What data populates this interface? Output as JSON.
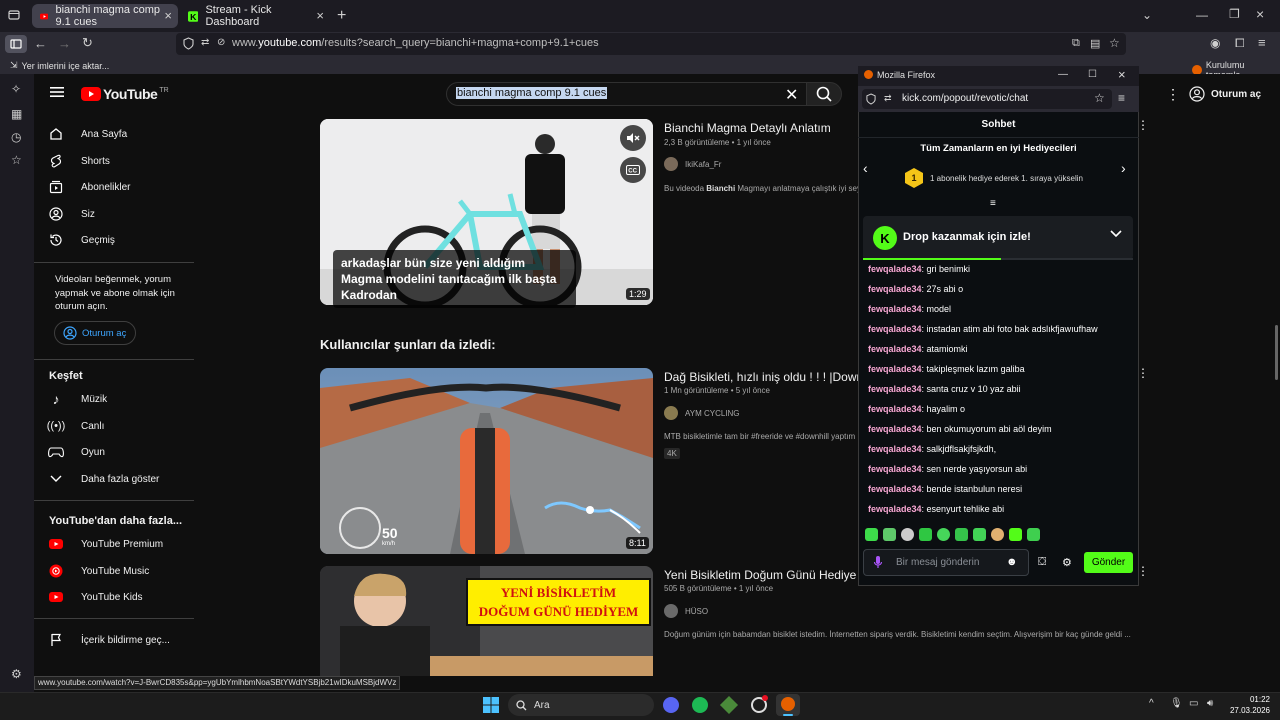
{
  "browser": {
    "tabs": [
      {
        "label": "bianchi magma comp 9.1 cues"
      },
      {
        "label": "Stream - Kick Dashboard"
      }
    ],
    "url_prefix": "www.",
    "url_host": "youtube.com",
    "url_path": "/results?search_query=bianchi+magma+comp+9.1+cues",
    "bookmarks_import": "Yer imlerini içe aktar...",
    "bookmarks_right": "Kurulumu tamamla",
    "status_url": "www.youtube.com/watch?v=J-BwrCD835s&pp=ygUbYmlhbmNoaSBtYWdtYSBjb21wIDkuMSBjdWVz"
  },
  "youtube": {
    "logo_text": "YouTube",
    "logo_region": "TR",
    "search_value": "bianchi magma comp 9.1 cues",
    "signin_label": "Oturum aç",
    "nav": [
      {
        "label": "Ana Sayfa"
      },
      {
        "label": "Shorts"
      },
      {
        "label": "Abonelikler"
      },
      {
        "label": "Siz"
      },
      {
        "label": "Geçmiş"
      }
    ],
    "signin_prompt": "Videoları beğenmek, yorum yapmak ve abone olmak için oturum açın.",
    "signin_button": "Oturum aç",
    "explore_heading": "Keşfet",
    "explore": [
      {
        "label": "Müzik"
      },
      {
        "label": "Canlı"
      },
      {
        "label": "Oyun"
      },
      {
        "label": "Daha fazla göster"
      }
    ],
    "more_heading": "YouTube'dan daha fazla...",
    "more": [
      {
        "label": "YouTube Premium"
      },
      {
        "label": "YouTube Music"
      },
      {
        "label": "YouTube Kids"
      }
    ],
    "report_history": "İçerik bildirme geç...",
    "section_heading": "Kullanıcılar şunları da izledi:",
    "videos": [
      {
        "title": "Bianchi Magma Detaylı Anlatım",
        "views": "2,3 B görüntüleme",
        "age": "1 yıl önce",
        "channel": "IkiKafa_Fr",
        "desc_pre": "Bu videoda ",
        "desc_bold": "Bianchi",
        "desc_post": " Magmayı anlatmaya çalıştık iyi sey",
        "duration": "1:29",
        "caption": "arkadaşlar bün size yeni aldığım Magma modelini tanıtacağım ilk başta Kadrodan"
      },
      {
        "title": "Dağ Bisikleti, hızlı iniş oldu ! ! ! |Down",
        "views": "1 Mn görüntüleme",
        "age": "5 yıl önce",
        "channel": "AYM CYCLING",
        "desc": "MTB bisikletimle tam bir #freeride ve #downhill yaptım",
        "badge": "4K",
        "duration": "8:11",
        "speed": "50",
        "speed_unit": "km/h"
      },
      {
        "title": "Yeni Bisikletim Doğum Günü Hediye",
        "views": "505 B görüntüleme",
        "age": "1 yıl önce",
        "channel": "HÜSO",
        "desc": "Doğum günüm için babamdan bisiklet istedim. İnternetten sipariş verdik. Bisikletimi kendim seçtim. Alışverişim bir kaç günde geldi ...",
        "thumb_text_1": "YENİ BİSİKLETİM",
        "thumb_text_2": "DOĞUM GÜNÜ HEDİYEM"
      }
    ]
  },
  "popup": {
    "window_title": "Mozilla Firefox",
    "url": "kick.com/popout/revotic/chat",
    "chat_title": "Sohbet",
    "gifters_title": "Tüm Zamanların en iyi Hediyecileri",
    "gifters_rank": "1",
    "gifters_sub": "1 abonelik hediye ederek 1. sıraya yükselin",
    "drop_label": "Drop kazanmak için izle!",
    "messages": [
      {
        "user": "fewqalade34",
        "text": "gri benimki"
      },
      {
        "user": "fewqalade34",
        "text": "27s abi o"
      },
      {
        "user": "fewqalade34",
        "text": "model"
      },
      {
        "user": "fewqalade34",
        "text": "instadan atim abi foto bak adslıkfjawıufhaw"
      },
      {
        "user": "fewqalade34",
        "text": "atamiomki"
      },
      {
        "user": "fewqalade34",
        "text": "takipleşmek lazım galiba"
      },
      {
        "user": "fewqalade34",
        "text": "santa cruz v 10 yaz abii"
      },
      {
        "user": "fewqalade34",
        "text": "hayalim o"
      },
      {
        "user": "fewqalade34",
        "text": "ben okumuyorum abi aöl deyim"
      },
      {
        "user": "fewqalade34",
        "text": "salkjdflsakjfsjkdh,"
      },
      {
        "user": "fewqalade34",
        "text": "sen nerde yaşıyorsun abi"
      },
      {
        "user": "fewqalade34",
        "text": "bende istanbulun neresi"
      },
      {
        "user": "fewqalade34",
        "text": "esenyurt tehlike abi"
      }
    ],
    "input_placeholder": "Bir mesaj gönderin",
    "send_label": "Gönder",
    "accent": "#53fc18"
  },
  "taskbar": {
    "search_label": "Ara",
    "time": "01:22",
    "date": "27.03.2026"
  }
}
